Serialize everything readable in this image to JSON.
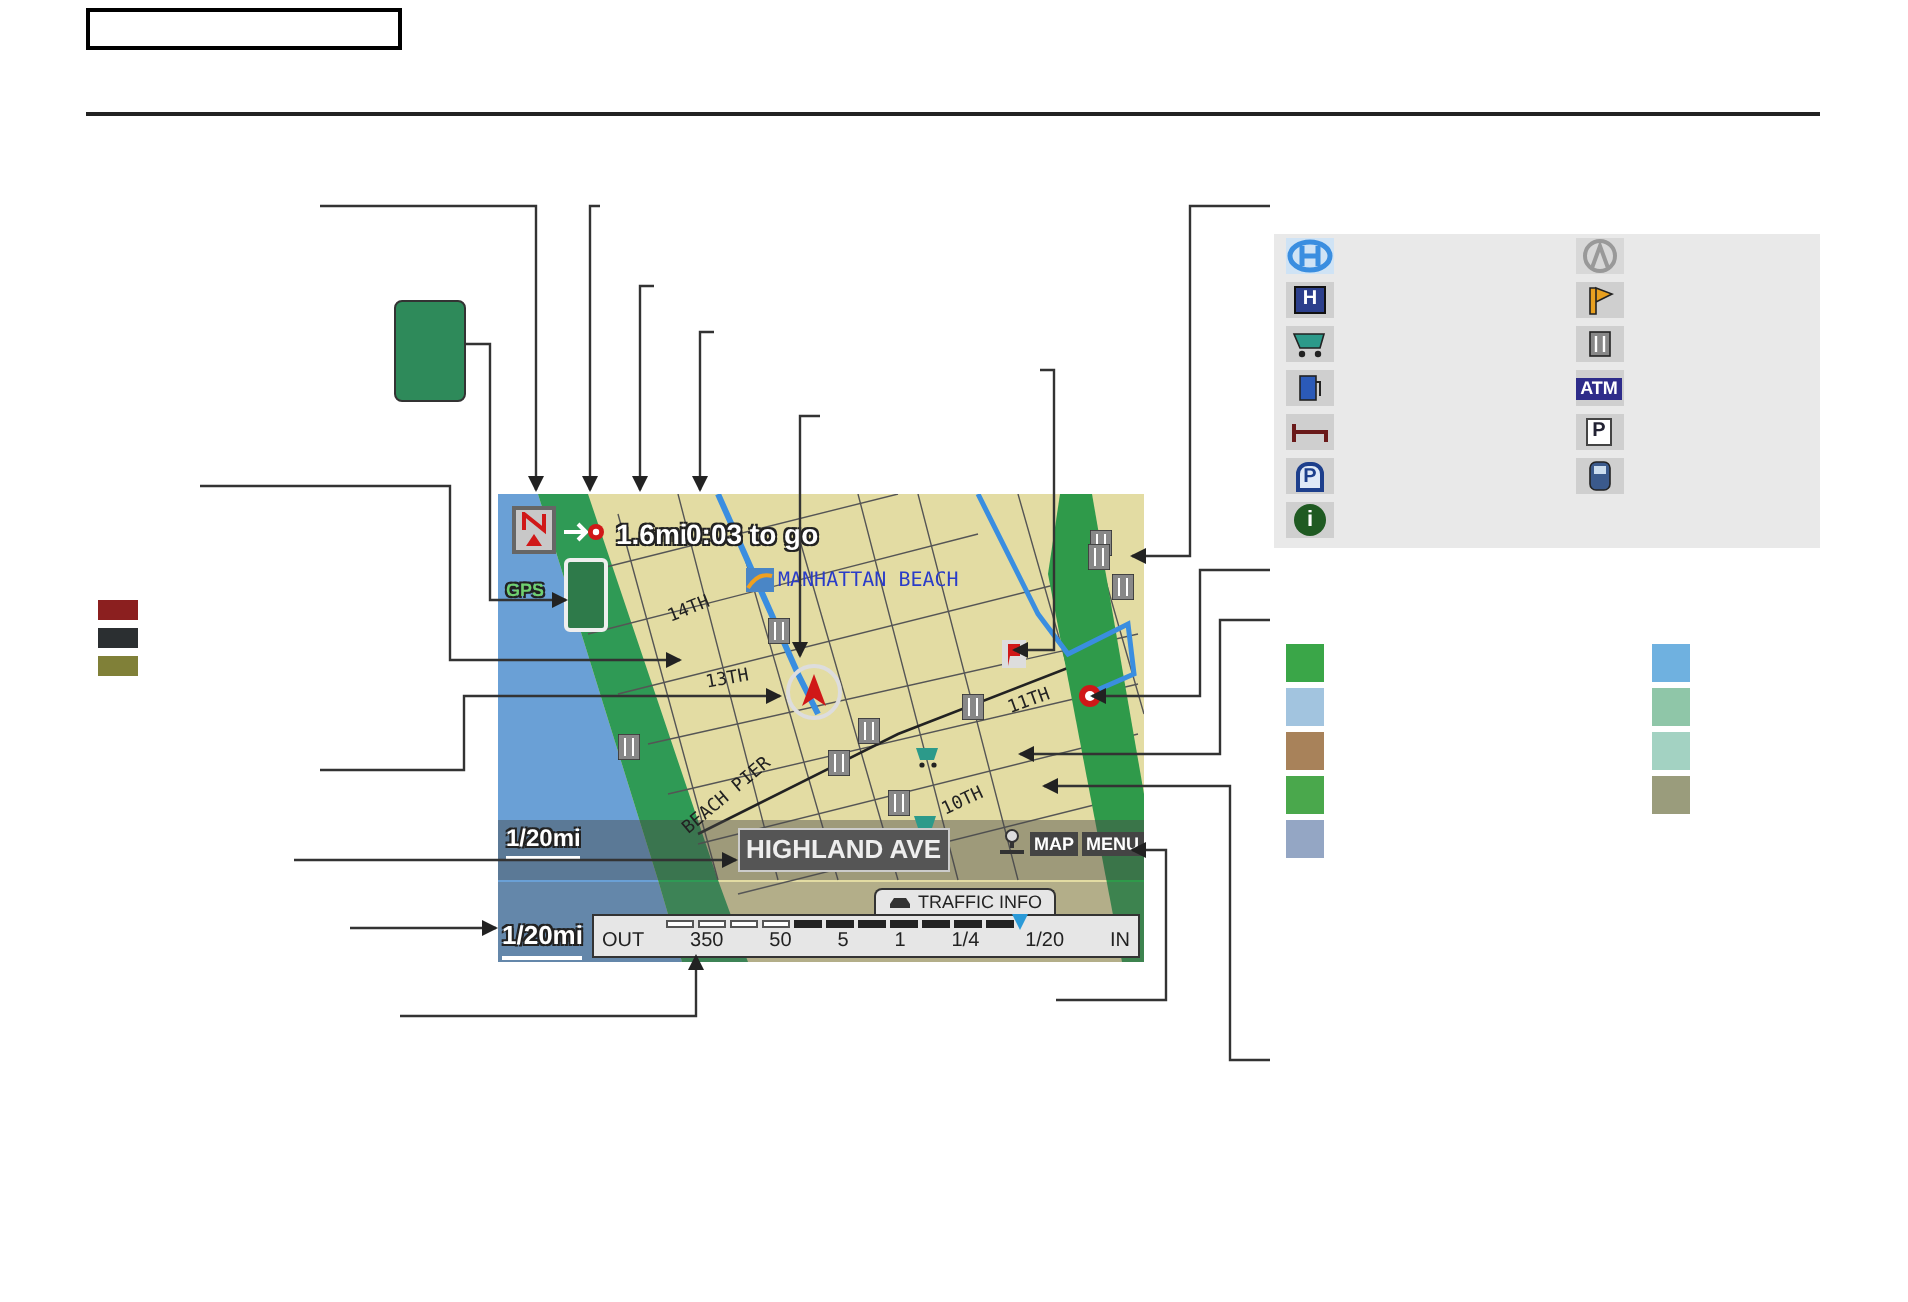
{
  "map_screen": {
    "distance": "1.6mi",
    "time_to_go": "0:03 to go",
    "city_label": "MANHATTAN BEACH",
    "gps_label": "GPS",
    "street_labels": [
      "14TH",
      "13TH",
      "11TH",
      "10TH",
      "BEACH PIER"
    ],
    "scale": "1/20mi",
    "current_street": "HIGHLAND AVE",
    "menu_buttons": [
      "MAP",
      "MENU"
    ]
  },
  "traffic_panel": {
    "scale": "1/20mi",
    "title": "TRAFFIC INFO",
    "bar_labels": [
      "OUT",
      "350",
      "50",
      "5",
      "1",
      "1/4",
      "1/20",
      "IN"
    ],
    "segments": [
      {
        "congested": false
      },
      {
        "congested": false
      },
      {
        "congested": false
      },
      {
        "congested": false
      },
      {
        "congested": true
      },
      {
        "congested": true
      },
      {
        "congested": true
      },
      {
        "congested": true
      },
      {
        "congested": true
      },
      {
        "congested": true
      },
      {
        "congested": true
      }
    ]
  },
  "route_legend": [
    {
      "color": "#8b1f1f"
    },
    {
      "color": "#2b2f31"
    },
    {
      "color": "#808038"
    }
  ],
  "poi_legend": [
    {
      "kind": "logo_h"
    },
    {
      "kind": "logo_a"
    },
    {
      "kind": "hospital",
      "glyph": "H"
    },
    {
      "kind": "attraction"
    },
    {
      "kind": "shopping"
    },
    {
      "kind": "restaurant"
    },
    {
      "kind": "gas"
    },
    {
      "kind": "atm",
      "glyph": "ATM"
    },
    {
      "kind": "lodging"
    },
    {
      "kind": "parking",
      "glyph": "P"
    },
    {
      "kind": "garage",
      "glyph": "P"
    },
    {
      "kind": "train"
    },
    {
      "kind": "info",
      "glyph": "i"
    }
  ],
  "area_legend": [
    {
      "color": "#3aa648"
    },
    {
      "color": "#6fb1e0"
    },
    {
      "color": "#a2c4df"
    },
    {
      "color": "#8fc6a8"
    },
    {
      "color": "#a8825a"
    },
    {
      "color": "#a3d2c2"
    },
    {
      "color": "#4aa84c"
    },
    {
      "color": "#9a9c7c"
    },
    {
      "color": "#94a6c4"
    }
  ]
}
